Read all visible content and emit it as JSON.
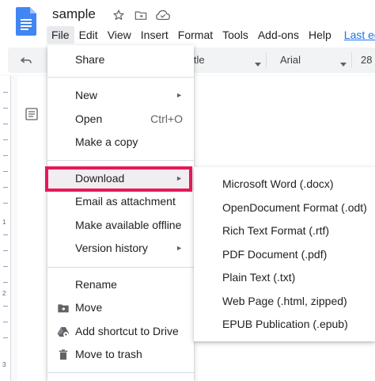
{
  "document": {
    "title": "sample"
  },
  "title_icons": [
    "star-icon",
    "folder-move-icon",
    "cloud-saved-icon"
  ],
  "menubar": [
    {
      "label": "File",
      "active": true
    },
    {
      "label": "Edit"
    },
    {
      "label": "View"
    },
    {
      "label": "Insert"
    },
    {
      "label": "Format"
    },
    {
      "label": "Tools"
    },
    {
      "label": "Add-ons"
    },
    {
      "label": "Help"
    },
    {
      "label": "Last ed"
    }
  ],
  "toolbar": {
    "style_partial": "itle",
    "font": "Arial",
    "font_size": "28"
  },
  "ruler": {
    "numbers": [
      "1",
      "2",
      "3"
    ]
  },
  "file_menu": {
    "items": [
      {
        "label": "Share"
      },
      {
        "label": "New",
        "arrow": "►"
      },
      {
        "label": "Open",
        "shortcut": "Ctrl+O"
      },
      {
        "label": "Make a copy"
      },
      {
        "label": "Download",
        "arrow": "►"
      },
      {
        "label": "Email as attachment"
      },
      {
        "label": "Make available offline"
      },
      {
        "label": "Version history",
        "arrow": "►"
      },
      {
        "label": "Rename"
      },
      {
        "label": "Move",
        "icon": "move-to-folder-icon"
      },
      {
        "label": "Add shortcut to Drive",
        "icon": "drive-shortcut-icon"
      },
      {
        "label": "Move to trash",
        "icon": "trash-icon"
      }
    ]
  },
  "download_menu": {
    "items": [
      {
        "label": "Microsoft Word (.docx)"
      },
      {
        "label": "OpenDocument Format (.odt)"
      },
      {
        "label": "Rich Text Format (.rtf)"
      },
      {
        "label": "PDF Document (.pdf)"
      },
      {
        "label": "Plain Text (.txt)"
      },
      {
        "label": "Web Page (.html, zipped)"
      },
      {
        "label": "EPUB Publication (.epub)"
      }
    ]
  },
  "colors": {
    "docs_blue": "#4285f4",
    "highlight": "#e8185a",
    "link": "#1a73e8"
  }
}
